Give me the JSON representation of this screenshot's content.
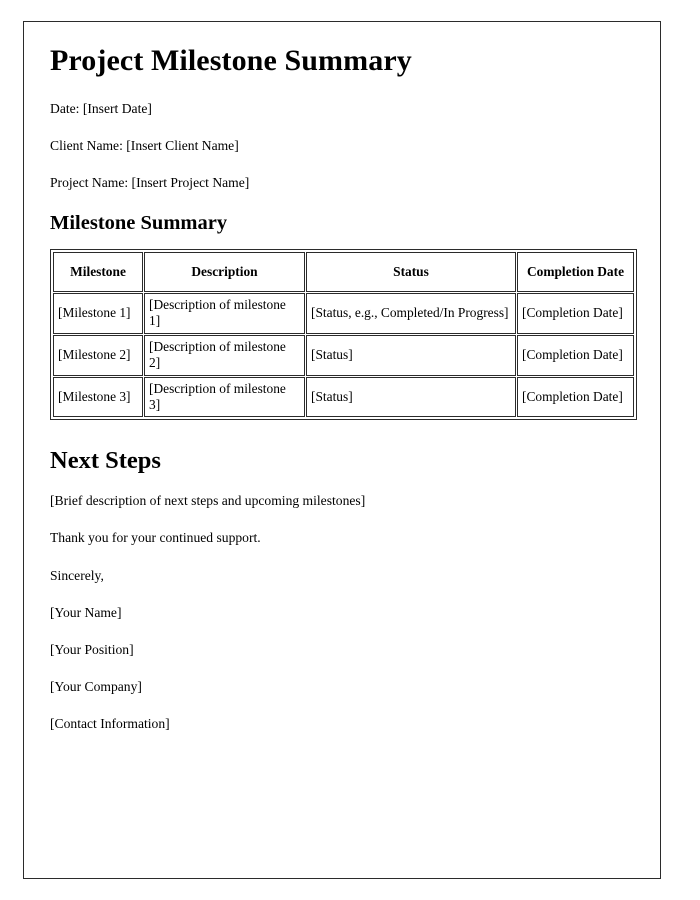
{
  "document": {
    "title": "Project Milestone Summary",
    "meta_lines": [
      "Date: [Insert Date]",
      "Client Name: [Insert Client Name]",
      "Project Name: [Insert Project Name]"
    ],
    "milestone_section": {
      "heading": "Milestone Summary",
      "table": {
        "columns": [
          "Milestone",
          "Description",
          "Status",
          "Completion Date"
        ],
        "rows": [
          {
            "milestone": "[Milestone 1]",
            "description": "[Description of milestone 1]",
            "status": "[Status, e.g., Completed/In Progress]",
            "completion_date": "[Completion Date]"
          },
          {
            "milestone": "[Milestone 2]",
            "description": "[Description of milestone 2]",
            "status": "[Status]",
            "completion_date": "[Completion Date]"
          },
          {
            "milestone": "[Milestone 3]",
            "description": "[Description of milestone 3]",
            "status": "[Status]",
            "completion_date": "[Completion Date]"
          }
        ]
      }
    },
    "next_steps_section": {
      "heading": "Next Steps",
      "body": "[Brief description of next steps and upcoming milestones]",
      "thanks": "Thank you for your continued support.",
      "closing": "Sincerely,"
    },
    "signature": {
      "name": "[Your Name]",
      "position": "[Your Position]",
      "company": "[Your Company]",
      "contact": "[Contact Information]"
    },
    "colors": {
      "page_background": "#ffffff",
      "text": "#000000",
      "border": "#2b2b2b"
    }
  }
}
